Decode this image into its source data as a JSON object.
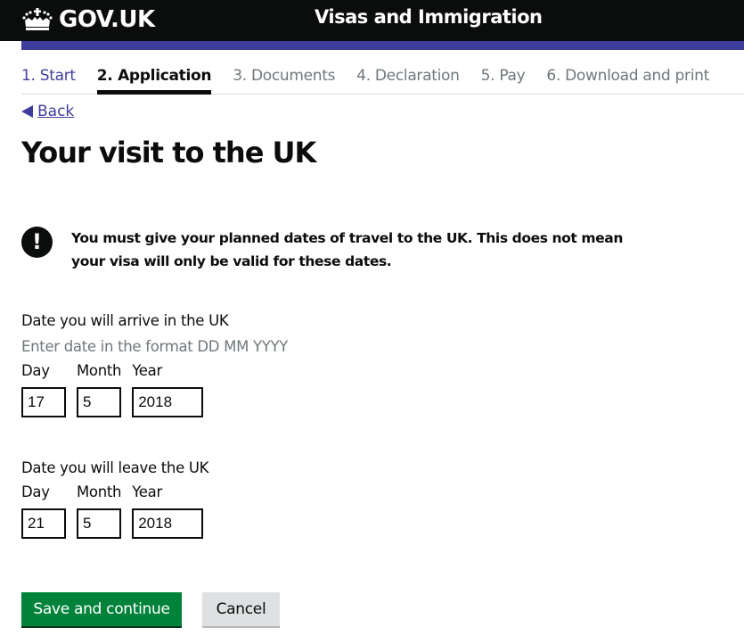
{
  "header": {
    "logo_text": "GOV.UK",
    "logo_icon": "crown-icon",
    "service_name": "Visas and Immigration",
    "accent_color": "#3e3d9c"
  },
  "steps": [
    {
      "label": "1. Start",
      "state": "done"
    },
    {
      "label": "2. Application",
      "state": "active"
    },
    {
      "label": "3. Documents",
      "state": "todo"
    },
    {
      "label": "4. Declaration",
      "state": "todo"
    },
    {
      "label": "5. Pay",
      "state": "todo"
    },
    {
      "label": "6. Download and print",
      "state": "todo"
    }
  ],
  "back_link": {
    "label": "Back",
    "icon": "triangle-left-icon"
  },
  "page_title": "Your visit to the UK",
  "warning": {
    "icon": "exclamation-icon",
    "symbol": "!",
    "text": "You must give your planned dates of travel to the UK. This does not mean your visa will only be valid for these dates."
  },
  "arrival": {
    "legend": "Date you will arrive in the UK",
    "hint": "Enter date in the format DD MM YYYY",
    "day_label": "Day",
    "month_label": "Month",
    "year_label": "Year",
    "day_value": "17",
    "month_value": "5",
    "year_value": "2018"
  },
  "departure": {
    "legend": "Date you will leave the UK",
    "day_label": "Day",
    "month_label": "Month",
    "year_label": "Year",
    "day_value": "21",
    "month_value": "5",
    "year_value": "2018"
  },
  "buttons": {
    "save_label": "Save and continue",
    "cancel_label": "Cancel",
    "primary_color": "#00823b"
  }
}
